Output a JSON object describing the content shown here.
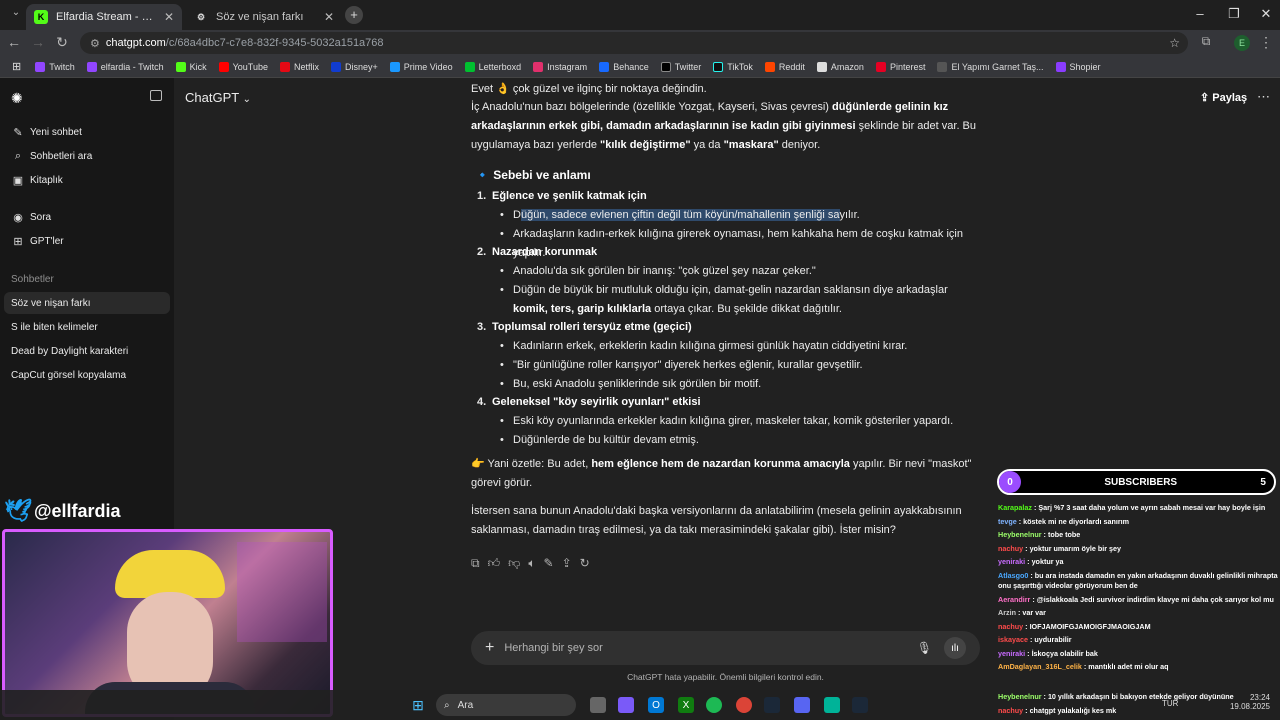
{
  "colors": {
    "accent": "#9b4dff",
    "kick": "#53fc18",
    "selection": "#2f4a6b"
  },
  "browser": {
    "tabs": [
      {
        "title": "Elfardia Stream - Watch Live on",
        "icon": "kick-icon",
        "active": true
      },
      {
        "title": "Söz ve nişan farkı",
        "icon": "openai-icon",
        "active": false
      }
    ],
    "url_host": "chatgpt.com",
    "url_path": "/c/68a4dbc7-c7e8-832f-9345-5032a151a768",
    "profile_initial": "E",
    "bookmarks": [
      "Twitch",
      "elfardia - Twitch",
      "Kick",
      "YouTube",
      "Netflix",
      "Disney+",
      "Prime Video",
      "Letterboxd",
      "Instagram",
      "Behance",
      "Twitter",
      "TikTok",
      "Reddit",
      "Amazon",
      "Pinterest",
      "El Yapımı Garnet Taş...",
      "Shopier"
    ]
  },
  "sidebar": {
    "actions": [
      {
        "label": "Yeni sohbet",
        "icon": "new-chat-icon"
      },
      {
        "label": "Sohbetleri ara",
        "icon": "search-icon"
      },
      {
        "label": "Kitaplık",
        "icon": "library-icon"
      },
      {
        "label": "Sora",
        "icon": "sora-icon"
      },
      {
        "label": "GPT'ler",
        "icon": "gpts-icon"
      }
    ],
    "section_title": "Sohbetler",
    "chats": [
      "Söz ve nişan farkı",
      "S ile biten kelimeler",
      "Dead by Daylight karakteri",
      "CapCut görsel kopyalama"
    ]
  },
  "header": {
    "model": "ChatGPT",
    "share": "Paylaş"
  },
  "message": {
    "intro1": "Evet 👌 çok güzel ve ilginç bir noktaya değindin.",
    "intro2a": "İç Anadolu'nun bazı bölgelerinde (özellikle Yozgat, Kayseri, Sivas çevresi) ",
    "intro2b": "düğünlerde gelinin kız arkadaşlarının erkek gibi, damadın arkadaşlarının ise kadın gibi giyinmesi",
    "intro2c": " şeklinde bir adet var. Bu uygulamaya bazı yerlerde ",
    "intro2d": "\"kılık değiştirme\"",
    "intro2e": " ya da ",
    "intro2f": "\"maskara\"",
    "intro2g": " deniyor.",
    "section_icon": "🔹",
    "section_title": "Sebebi ve anlamı",
    "items": [
      {
        "n": "1.",
        "title": "Eğlence ve şenlik katmak için"
      },
      {
        "n": "2.",
        "title": "Nazardan korunmak"
      },
      {
        "n": "3.",
        "title": "Toplumsal rolleri tersyüz etme (geçici)"
      },
      {
        "n": "4.",
        "title": "Geleneksel \"köy seyirlik oyunları\" etkisi"
      }
    ],
    "b1_1a": "D",
    "b1_1b": "üğün, sadece evlenen çiftin değil tüm köyün/mahallenin şenliği sa",
    "b1_1c": "yılır.",
    "b1_2": "Arkadaşların kadın-erkek kılığına girerek oynaması, hem kahkaha hem de coşku katmak için yapılır.",
    "b2_1": "Anadolu'da sık görülen bir inanış: \"çok güzel şey nazar çeker.\"",
    "b2_2a": "Düğün de büyük bir mutluluk olduğu için, damat-gelin nazardan saklansın diye arkadaşlar ",
    "b2_2b": "komik, ters, garip kılıklarla",
    "b2_2c": " ortaya çıkar. Bu şekilde dikkat dağıtılır.",
    "b3_1": "Kadınların erkek, erkeklerin kadın kılığına girmesi günlük hayatın ciddiyetini kırar.",
    "b3_2": "\"Bir günlüğüne roller karışıyor\" diyerek herkes eğlenir, kurallar gevşetilir.",
    "b3_3": "Bu, eski Anadolu şenliklerinde sık görülen bir motif.",
    "b4_1": "Eski köy oyunlarında erkekler kadın kılığına girer, maskeler takar, komik gösteriler yapardı.",
    "b4_2": "Düğünlerde de bu kültür devam etmiş.",
    "summary_a": "👉 Yani özetle: Bu adet, ",
    "summary_b": "hem eğlence hem de nazardan korunma amacıyla",
    "summary_c": " yapılır. Bir nevi \"maskot\" görevi görür.",
    "closing": "İstersen sana bunun Anadolu'daki başka versiyonlarını da anlatabilirim (mesela gelinin ayakkabısının saklanması, damadın tıraş edilmesi, ya da takı merasimindeki şakalar gibi). İster misin?"
  },
  "composer": {
    "placeholder": "Herhangi bir şey sor",
    "disclaimer": "ChatGPT hata yapabilir. Önemli bilgileri kontrol edin."
  },
  "overlay": {
    "twitter_handle": "@ellfardia",
    "subscribers_label": "SUBSCRIBERS",
    "subs_left": "0",
    "subs_right": "5",
    "chat": [
      {
        "user": "Karapalaz",
        "color": "#53fc18",
        "msg": "Şarj %7 3 saat daha yolum ve ayrın sabah mesai var hay boyle işin"
      },
      {
        "user": "tevge",
        "color": "#7fb3ff",
        "msg": "köstek mi ne diyorlardı sanırım"
      },
      {
        "user": "Heybenelnur",
        "color": "#9cff6a",
        "msg": "tobe tobe"
      },
      {
        "user": "nachuy",
        "color": "#ff4b4b",
        "msg": "yoktur umarım öyle bir şey"
      },
      {
        "user": "yeniraki",
        "color": "#c86bff",
        "msg": "yoktur ya"
      },
      {
        "user": "Atlasgo0",
        "color": "#4aa8ff",
        "msg": "bu ara instada damadın en yakın arkadaşının duvaklı gelinlikli mihrapta onu şaşırttığı videolar görüyorum ben de"
      },
      {
        "user": "Aerandirr",
        "color": "#ff70c8",
        "msg": "@islakkoala Jedi survivor indirdim klavye mi daha çok sarıyor kol mu"
      },
      {
        "user": "Arzin",
        "color": "#cfcfcf",
        "msg": "var var"
      },
      {
        "user": "nachuy",
        "color": "#ff4b4b",
        "msg": "IOFJAMOIFGJAMOIGFJMAOIGJAM"
      },
      {
        "user": "iskayace",
        "color": "#ff4b4b",
        "msg": "uydurabilir"
      },
      {
        "user": "yeniraki",
        "color": "#c86bff",
        "msg": "İskoçya olabilir bak"
      },
      {
        "user": "AmDaglayan_316L_celik",
        "color": "#ffb347",
        "msg": "mantıklı adet mi olur aq"
      },
      {
        "user": "Heybenelnur",
        "color": "#9cff6a",
        "msg": "10 yıllık arkadaşın bi bakıyon etekde geliyor düyününe"
      },
      {
        "user": "nachuy",
        "color": "#ff4b4b",
        "msg": "chatgpt yalakalığı kes mk"
      }
    ]
  },
  "taskbar": {
    "search": "Ara",
    "lang": "TUR",
    "time": "23:24",
    "date": "19.08.2025"
  }
}
